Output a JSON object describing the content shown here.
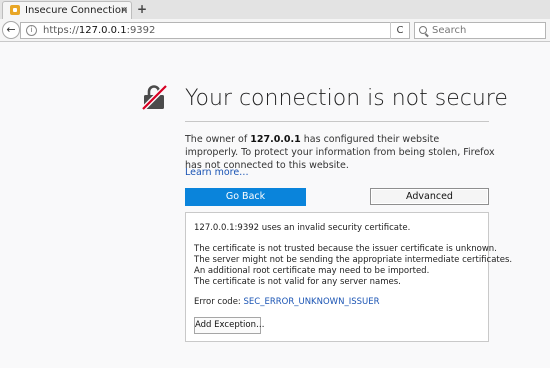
{
  "tab": {
    "title": "Insecure Connection",
    "close": "×"
  },
  "new_tab": "+",
  "nav": {
    "back": "←",
    "url_prefix": "https://",
    "url_host": "127.0.0.1",
    "url_suffix": ":9392",
    "reload": "C",
    "search_placeholder": "Search"
  },
  "error": {
    "title": "Your connection is not secure",
    "desc_1": "The owner of ",
    "desc_host": "127.0.0.1",
    "desc_2": " has configured their website improperly. To protect your information from being stolen, Firefox has not connected to this website.",
    "learn_more": "Learn more…",
    "go_back": "Go Back",
    "advanced": "Advanced"
  },
  "details": {
    "intro": "127.0.0.1:9392 uses an invalid security certificate.",
    "lines": [
      "The certificate is not trusted because the issuer certificate is unknown.",
      "The server might not be sending the appropriate intermediate certificates.",
      "An additional root certificate may need to be imported.",
      "The certificate is not valid for any server names."
    ],
    "error_code_label": "Error code: ",
    "error_code": "SEC_ERROR_UNKNOWN_ISSUER",
    "add_exception": "Add Exception…"
  },
  "colors": {
    "accent": "#0a84db",
    "link": "#1a54b4",
    "warning_slash": "#d70022"
  }
}
